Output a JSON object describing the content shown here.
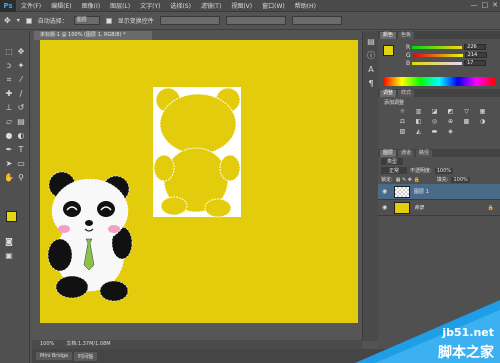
{
  "app": {
    "logo": "Ps"
  },
  "menu": [
    "文件(F)",
    "编辑(E)",
    "图像(I)",
    "图层(L)",
    "文字(Y)",
    "选择(S)",
    "滤镜(T)",
    "视图(V)",
    "窗口(W)",
    "帮助(H)"
  ],
  "window_controls": [
    "—",
    "□",
    "✕"
  ],
  "options": {
    "auto_select_label": "自动选择：",
    "auto_select_value": "图层",
    "show_transform_label": "显示变换控件"
  },
  "document": {
    "tab_title": "未标题-1 @ 100% (图层 1, RGB/8) *",
    "zoom": "100%",
    "doc_info": "文档:1.37M/1.08M"
  },
  "bottom_tabs": [
    "Mini Bridge",
    "时间轴"
  ],
  "color_panel": {
    "tabs": [
      "颜色",
      "色板"
    ],
    "r_label": "R",
    "g_label": "G",
    "b_label": "B",
    "r": "226",
    "g": "214",
    "b": "17"
  },
  "adjust_panel": {
    "tabs": [
      "调整",
      "样式"
    ],
    "title": "添加调整"
  },
  "layers_panel": {
    "tabs": [
      "图层",
      "通道",
      "路径"
    ],
    "kind": "类型",
    "blend_mode": "正常",
    "opacity_label": "不透明度:",
    "opacity": "100%",
    "lock_label": "锁定:",
    "fill_label": "填充:",
    "fill": "100%",
    "layers": [
      {
        "name": "图层 1"
      },
      {
        "name": "背景"
      }
    ]
  },
  "watermark": {
    "site": "jb51.net",
    "brand": "脚本之家"
  },
  "colors": {
    "canvas": "#e3cc0c",
    "accent": "#1f9ee8"
  }
}
